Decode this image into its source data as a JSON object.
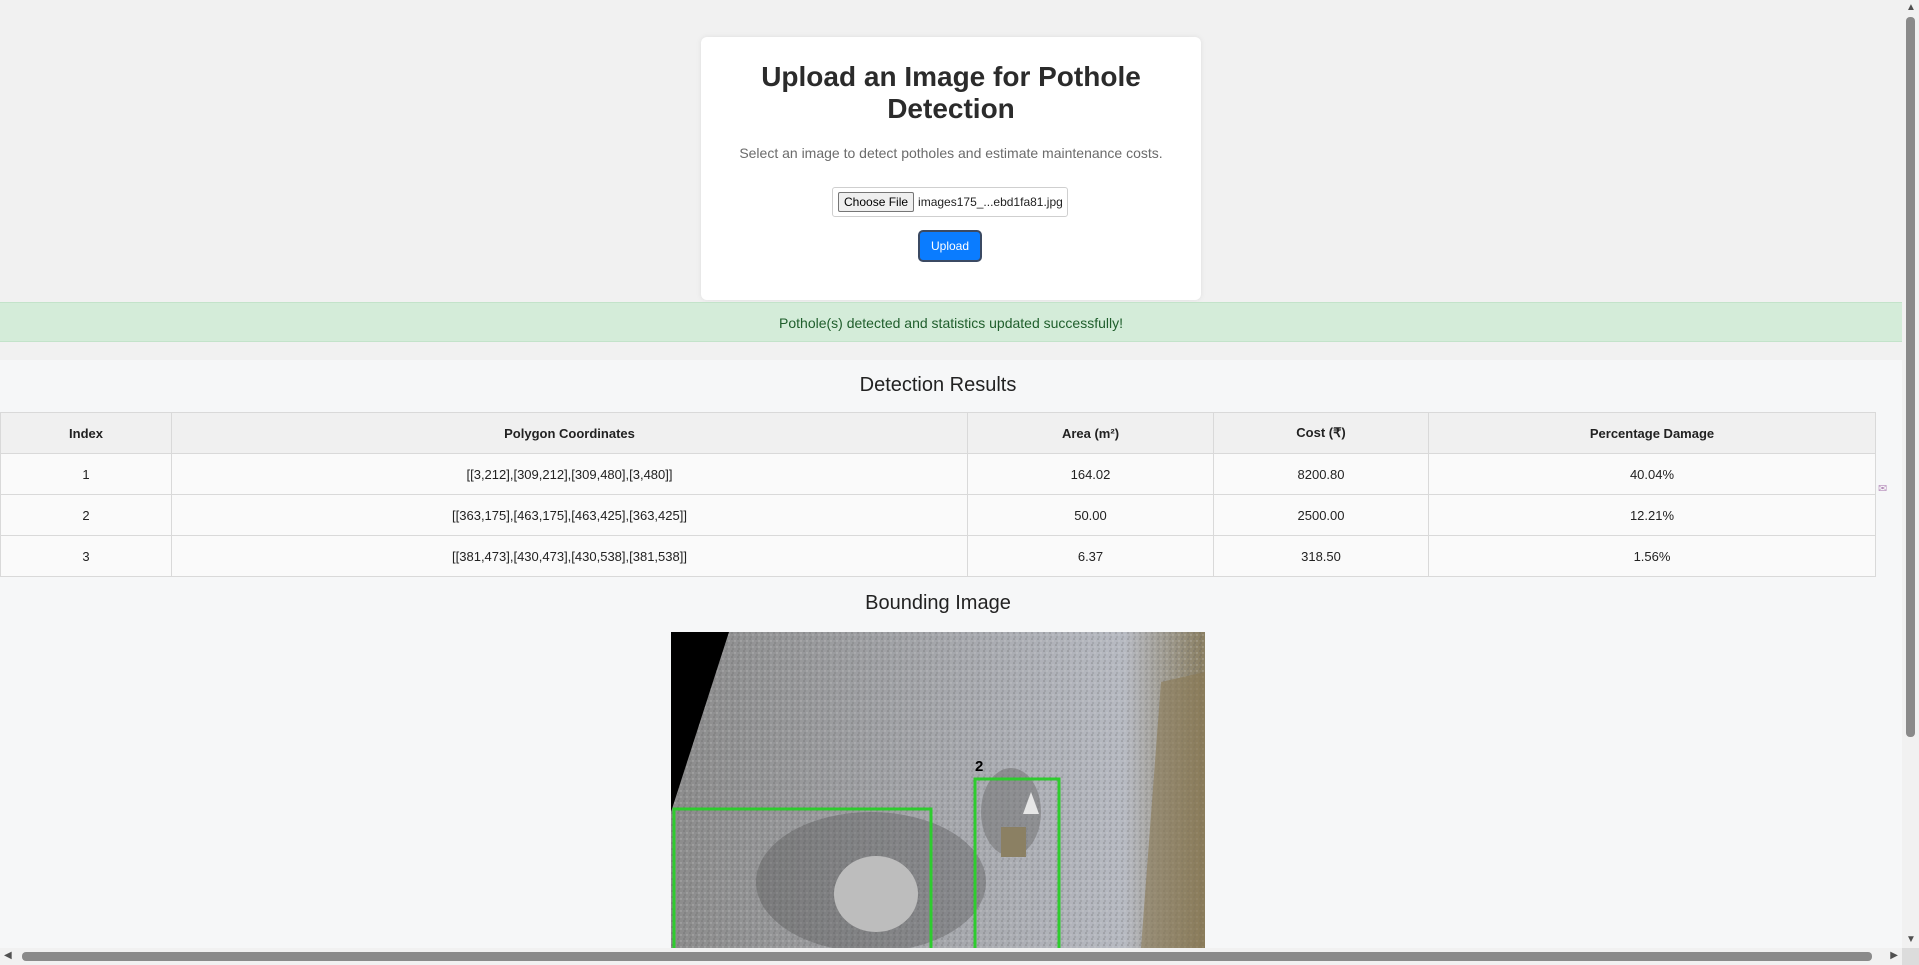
{
  "upload": {
    "title": "Upload an Image for Pothole Detection",
    "subtitle": "Select an image to detect potholes and estimate maintenance costs.",
    "choose_file_label": "Choose File",
    "file_name": "images175_...ebd1fa81.jpg",
    "upload_label": "Upload"
  },
  "banner": {
    "message": "Pothole(s) detected and statistics updated successfully!"
  },
  "results": {
    "title": "Detection Results",
    "headers": {
      "index": "Index",
      "polygon": "Polygon Coordinates",
      "area": "Area (m²)",
      "cost": "Cost (₹)",
      "damage": "Percentage Damage"
    },
    "rows": [
      {
        "index": "1",
        "polygon": "[[3,212],[309,212],[309,480],[3,480]]",
        "area": "164.02",
        "cost": "8200.80",
        "damage": "40.04%"
      },
      {
        "index": "2",
        "polygon": "[[363,175],[463,175],[463,425],[363,425]]",
        "area": "50.00",
        "cost": "2500.00",
        "damage": "12.21%"
      },
      {
        "index": "3",
        "polygon": "[[381,473],[430,473],[430,538],[381,538]]",
        "area": "6.37",
        "cost": "318.50",
        "damage": "1.56%"
      }
    ]
  },
  "bounding": {
    "title": "Bounding Image",
    "box_label": "2",
    "box_color": "#2ecc2e"
  },
  "icons": {
    "side": "extension-icon",
    "up": "arrow-up-icon",
    "down": "arrow-down-icon",
    "left": "arrow-left-icon",
    "right": "arrow-right-icon"
  },
  "colors": {
    "accent": "#0a7cff",
    "success_bg": "#d4ecd9",
    "success_text": "#1f5e2c"
  }
}
